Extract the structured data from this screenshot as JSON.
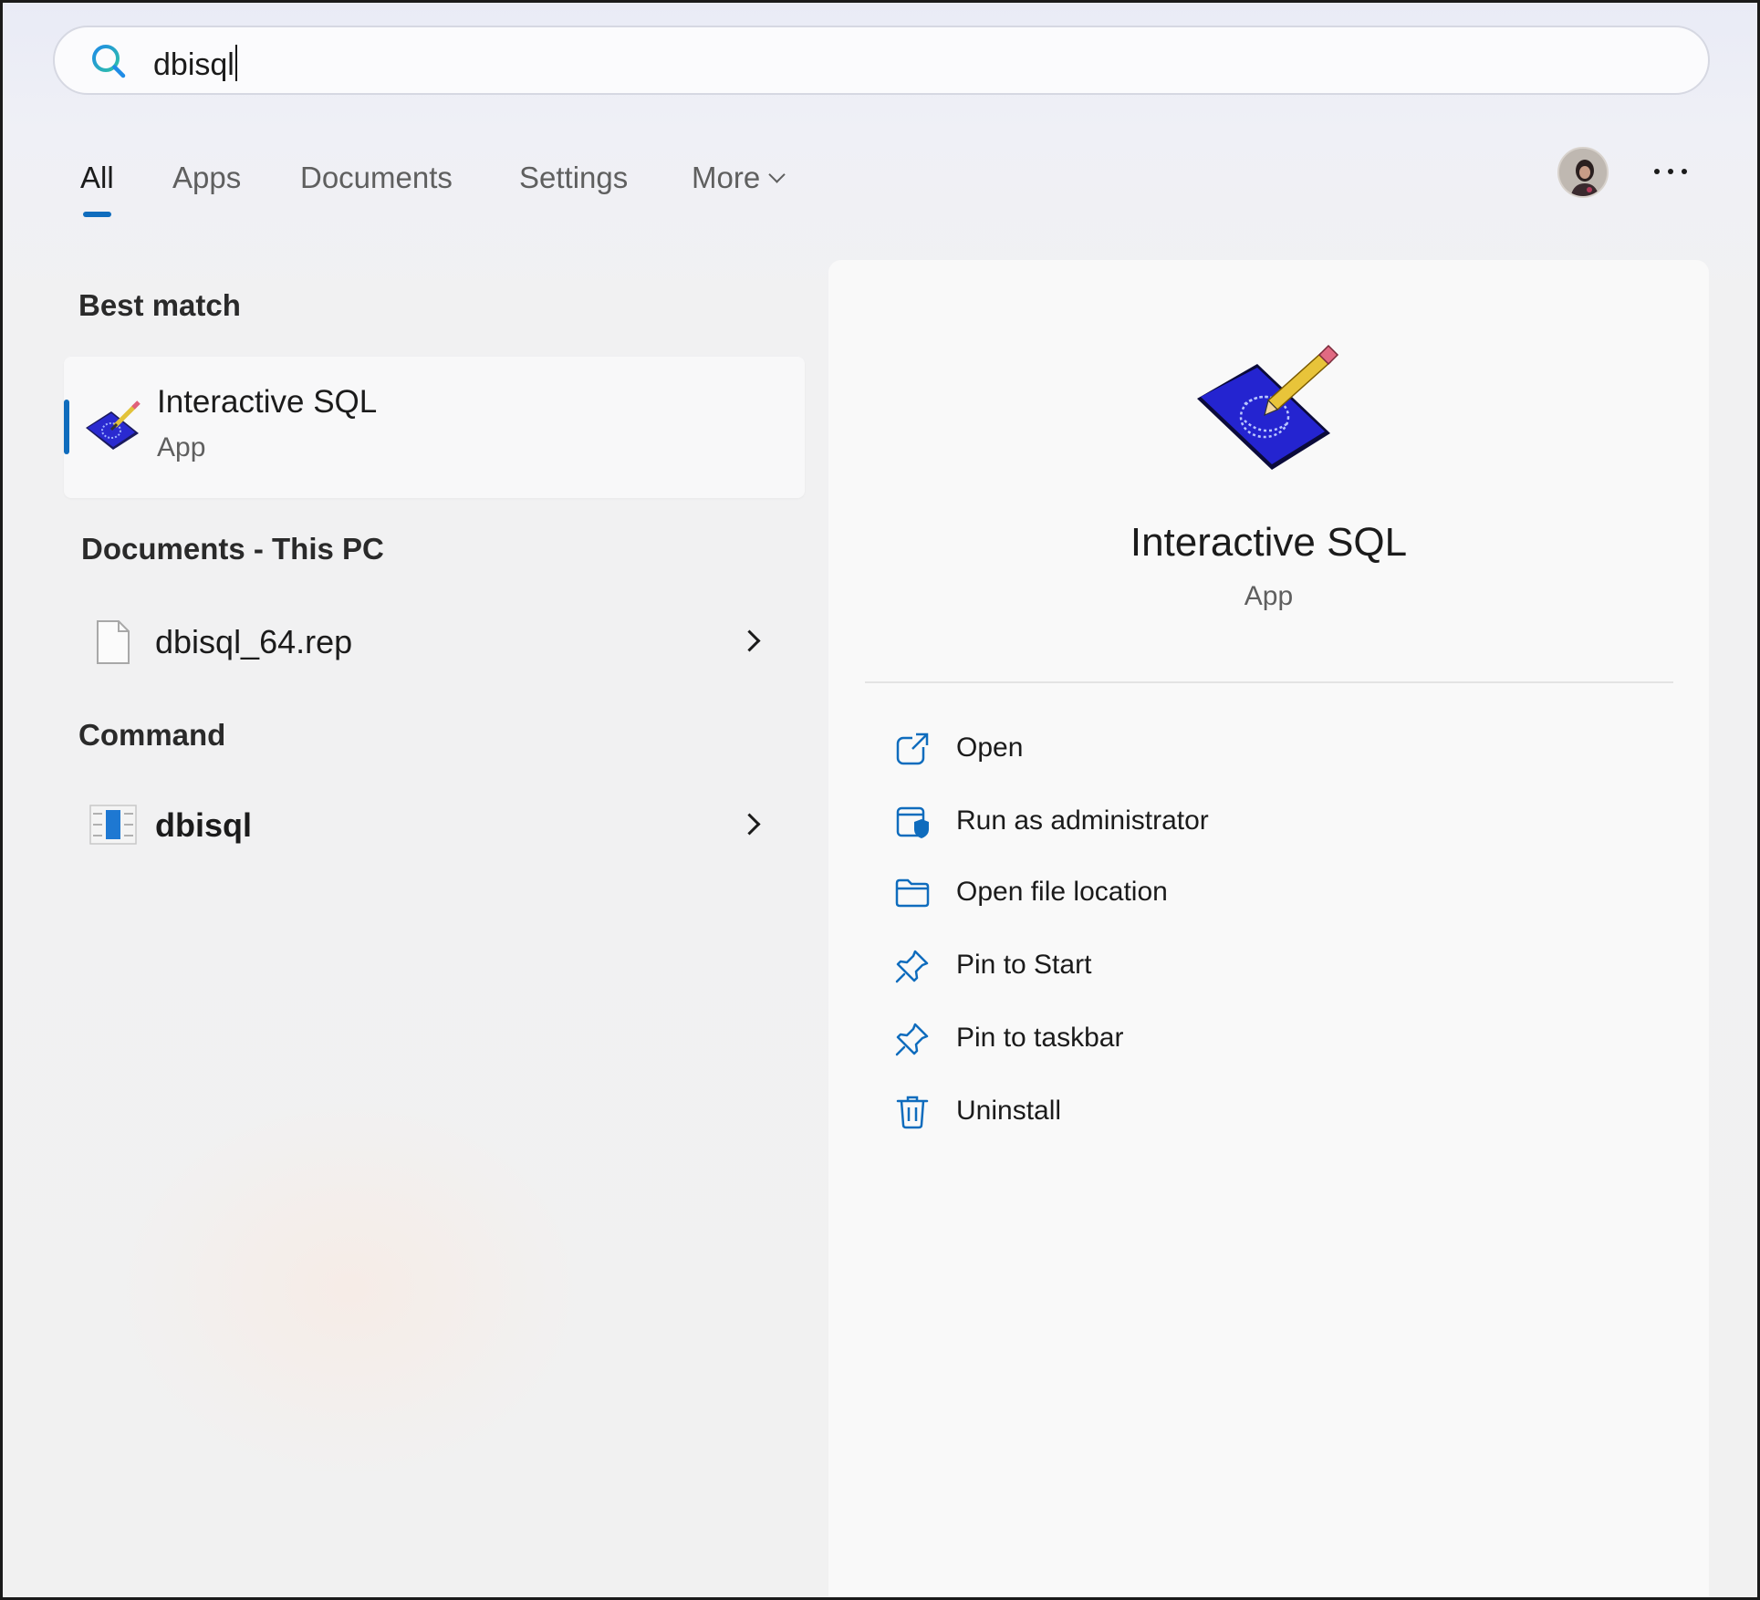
{
  "search": {
    "query": "dbisql"
  },
  "tabs": [
    {
      "label": "All",
      "active": true
    },
    {
      "label": "Apps"
    },
    {
      "label": "Documents"
    },
    {
      "label": "Settings"
    },
    {
      "label": "More"
    }
  ],
  "best_match": {
    "heading": "Best match",
    "title": "Interactive SQL",
    "subtitle": "App"
  },
  "documents": {
    "heading": "Documents - This PC",
    "items": [
      {
        "label": "dbisql_64.rep"
      }
    ]
  },
  "command": {
    "heading": "Command",
    "items": [
      {
        "label": "dbisql"
      }
    ]
  },
  "detail": {
    "title": "Interactive SQL",
    "subtitle": "App",
    "actions": [
      {
        "label": "Open",
        "icon": "open-external-icon"
      },
      {
        "label": "Run as administrator",
        "icon": "shield-admin-icon"
      },
      {
        "label": "Open file location",
        "icon": "folder-icon"
      },
      {
        "label": "Pin to Start",
        "icon": "pin-icon"
      },
      {
        "label": "Pin to taskbar",
        "icon": "pin-icon"
      },
      {
        "label": "Uninstall",
        "icon": "trash-icon"
      }
    ]
  },
  "colors": {
    "accent": "#0f6cbd",
    "app_icon_blue": "#2323c8"
  }
}
